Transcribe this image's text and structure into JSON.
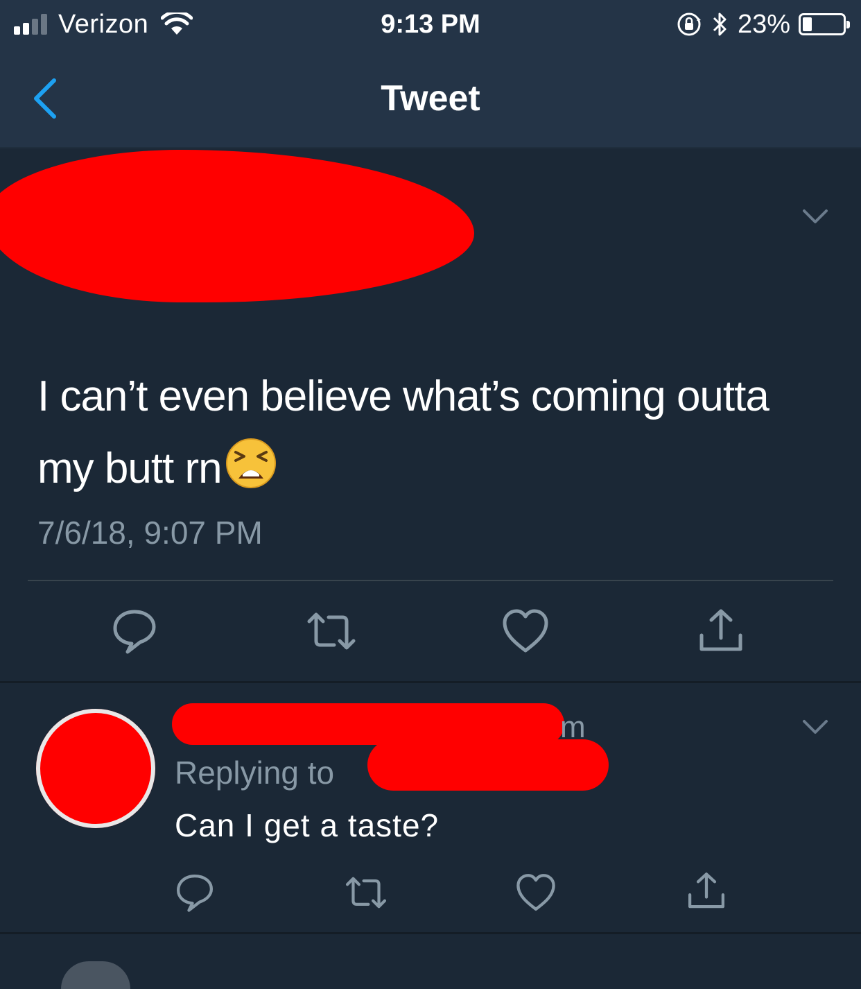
{
  "status_bar": {
    "carrier": "Verizon",
    "time": "9:13 PM",
    "battery_percent": "23%",
    "battery_level": 0.23,
    "signal_bars": 2
  },
  "nav": {
    "title": "Tweet",
    "back_icon": "chevron-left-icon"
  },
  "tweet": {
    "author": "[redacted]",
    "text": "I can’t even believe what’s coming outta my butt rn",
    "emoji": "tired-face",
    "timestamp": "7/6/18, 9:07 PM",
    "actions": [
      "reply-icon",
      "retweet-icon",
      "like-icon",
      "share-icon"
    ]
  },
  "reply": {
    "name_tail": "m",
    "replying_to_label": "Replying to",
    "text": "Can I get a taste?",
    "actions": [
      "reply-icon",
      "retweet-icon",
      "like-icon",
      "share-icon"
    ]
  },
  "colors": {
    "background": "#1b2836",
    "bar": "#243447",
    "accent": "#1da1f2",
    "secondary_text": "#8899a6",
    "redaction": "#ff0000"
  }
}
